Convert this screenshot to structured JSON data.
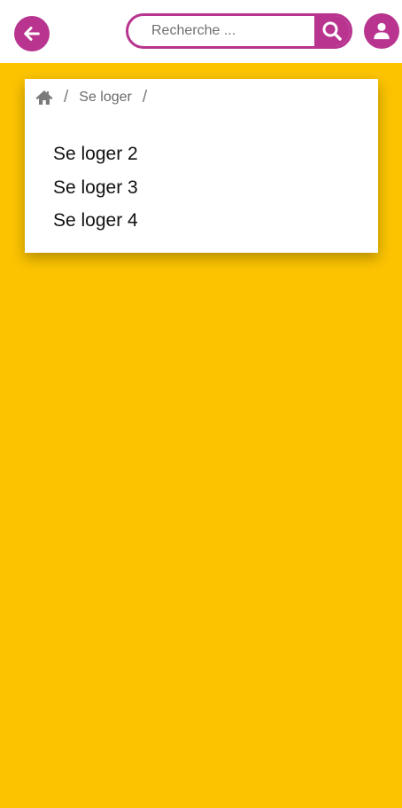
{
  "header": {
    "back_icon": "arrow-left-icon",
    "search": {
      "placeholder": "Recherche ...",
      "value": "",
      "icon": "search-icon"
    },
    "user_icon": "user-icon"
  },
  "breadcrumb": {
    "home_icon": "home-icon",
    "separator": "/",
    "items": [
      {
        "label": "Se loger"
      }
    ]
  },
  "menu": {
    "items": [
      {
        "label": "Se loger 2"
      },
      {
        "label": "Se loger 3"
      },
      {
        "label": "Se loger 4"
      }
    ]
  },
  "colors": {
    "accent": "#b8348f",
    "page_background": "#fbc300",
    "card_background": "#ffffff"
  }
}
